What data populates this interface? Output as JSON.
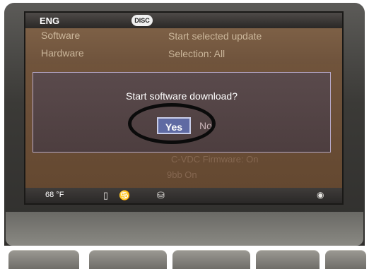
{
  "topbar": {
    "language": "ENG",
    "media_source": "DISC"
  },
  "menu": {
    "items": [
      {
        "left": "Software",
        "right": "Start selected update"
      },
      {
        "left": "Hardware",
        "right": "Selection: All"
      }
    ]
  },
  "dialog": {
    "message": "Start software download?",
    "yes_label": "Yes",
    "no_label": "No"
  },
  "background_rows": [
    "C-VDC Firmware: On",
    "9bb  On"
  ],
  "statusbar": {
    "temperature": "68 °F",
    "icons": [
      "phone-icon",
      "signal-icon",
      "lock-icon",
      "gps-icon"
    ]
  },
  "colors": {
    "screen_bg": "#6b4f38",
    "dialog_border": "#b7a9c9",
    "selected_button": "#5f6aa3",
    "annotation_ring": "#0b0b0b"
  }
}
